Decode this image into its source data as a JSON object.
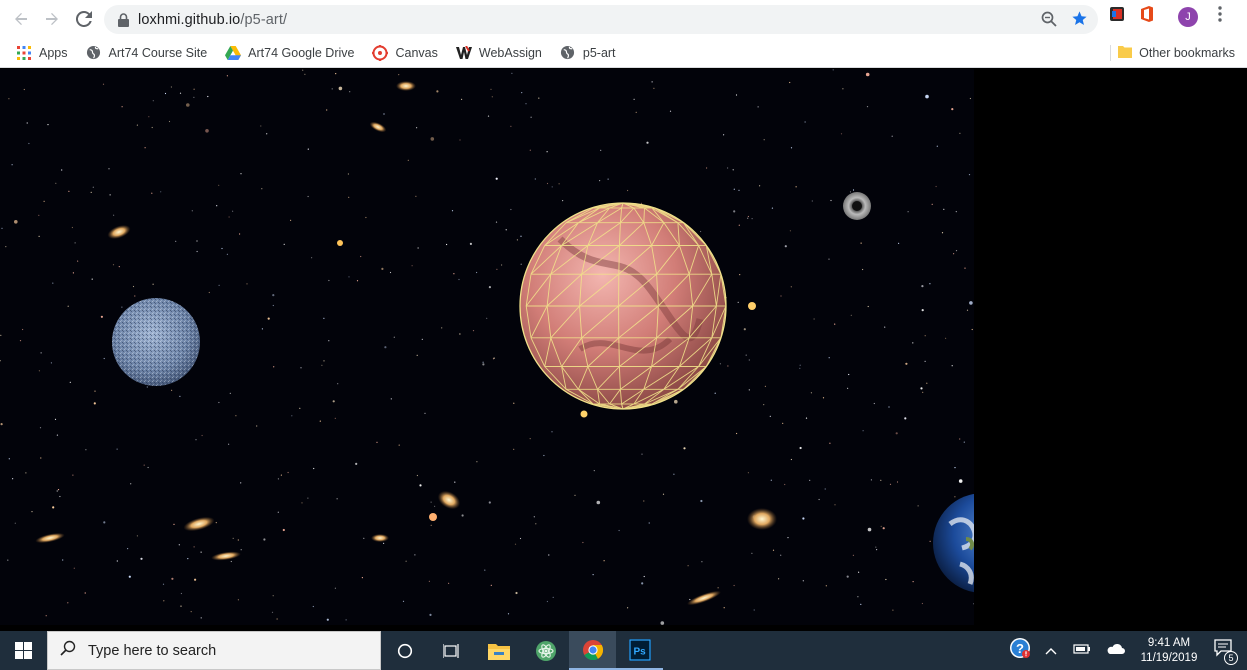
{
  "browser": {
    "url_host": "loxhmi.github.io",
    "url_path": "/p5-art/",
    "profile_initial": "J"
  },
  "bookmarks": {
    "items": [
      {
        "label": "Apps",
        "icon": "apps-grid-icon"
      },
      {
        "label": "Art74 Course Site",
        "icon": "globe-icon"
      },
      {
        "label": "Art74 Google Drive",
        "icon": "google-drive-icon"
      },
      {
        "label": "Canvas",
        "icon": "canvas-icon"
      },
      {
        "label": "WebAssign",
        "icon": "webassign-icon"
      },
      {
        "label": "p5-art",
        "icon": "globe-icon"
      }
    ],
    "other": "Other bookmarks"
  },
  "taskbar": {
    "search_placeholder": "Type here to search",
    "time": "9:41 AM",
    "date": "11/19/2019",
    "notification_count": "5"
  },
  "colors": {
    "accent_blue": "#1a73e8",
    "taskbar_bg": "#1f2e3c",
    "star": "#1a73e8"
  }
}
